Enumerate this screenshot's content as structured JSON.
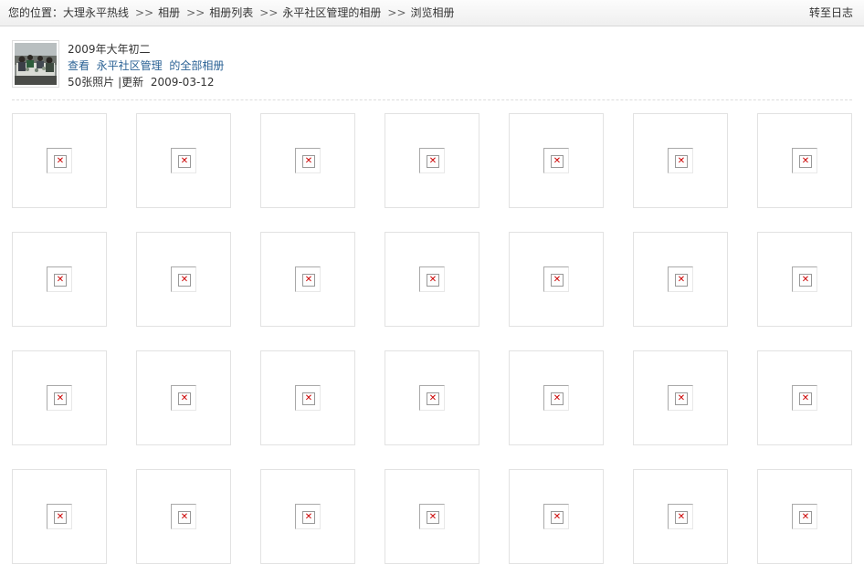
{
  "breadcrumb": {
    "prefix": "您的位置：",
    "separator": ">>",
    "items": [
      "大理永平热线",
      "相册",
      "相册列表",
      "永平社区管理的相册",
      "浏览相册"
    ]
  },
  "to_blog_label": "转至日志",
  "album": {
    "title": "2009年大年初二",
    "view_prefix": "查看",
    "owner": "永平社区管理",
    "view_suffix": "的全部相册",
    "photo_count": "50张照片",
    "meta_separator": "|",
    "updated_label": "更新",
    "updated_date": "2009-03-12"
  },
  "photos": {
    "columns": 7,
    "visible_rows": 4,
    "broken_icon": "broken-image-icon",
    "broken_glyph": "✕"
  },
  "colors": {
    "link": "#2b6295",
    "broken_x": "#cc0000"
  }
}
